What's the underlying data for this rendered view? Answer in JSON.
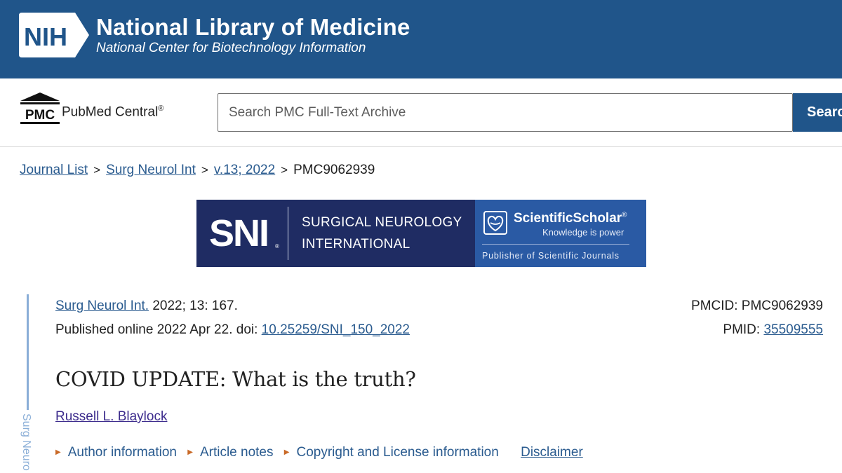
{
  "nih": {
    "logo_text": "NIH",
    "title": "National Library of Medicine",
    "subtitle": "National Center for Biotechnology Information"
  },
  "pmc": {
    "logo_text": "PMC",
    "name": "PubMed Central",
    "reg": "®",
    "search_placeholder": "Search PMC Full-Text Archive",
    "search_button": "Search"
  },
  "breadcrumb": {
    "items": [
      "Journal List",
      "Surg Neurol Int",
      "v.13; 2022"
    ],
    "current": "PMC9062939",
    "separator": ">"
  },
  "journal_banner": {
    "logo": "SNI",
    "name_line1": "SURGICAL NEUROLOGY",
    "name_line2": "INTERNATIONAL",
    "publisher": "ScientificScholar",
    "publisher_reg": "®",
    "tagline": "Knowledge is power",
    "publisher_desc": "Publisher of Scientific Journals"
  },
  "citation": {
    "journal_link": "Surg Neurol Int.",
    "issue": "2022; 13: 167.",
    "published": "Published online 2022 Apr 22. doi: ",
    "doi": "10.25259/SNI_150_2022",
    "pmcid_label": "PMCID: ",
    "pmcid": "PMC9062939",
    "pmid_label": "PMID: ",
    "pmid": "35509555"
  },
  "side_label": "Surg Neuro",
  "article": {
    "title": "COVID UPDATE: What is the truth?",
    "author": "Russell L. Blaylock"
  },
  "info_links": [
    "Author information",
    "Article notes",
    "Copyright and License information"
  ],
  "disclaimer": "Disclaimer",
  "colors": {
    "nih_blue": "#20558a",
    "link": "#2a5b8f",
    "journal_navy": "#1f2c63",
    "publisher_blue": "#2a5aa4",
    "triangle": "#c96a28"
  }
}
